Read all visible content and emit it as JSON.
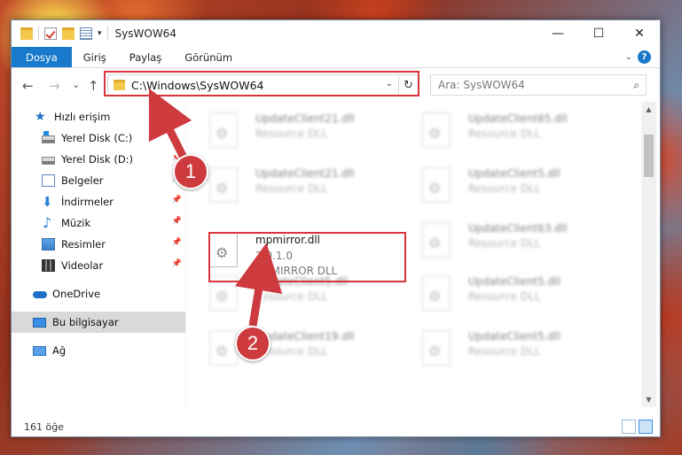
{
  "window": {
    "title": "SysWOW64",
    "minimize_glyph": "—",
    "maximize_glyph": "☐",
    "close_glyph": "✕"
  },
  "ribbon": {
    "tabs": [
      {
        "label": "Dosya",
        "active": true
      },
      {
        "label": "Giriş"
      },
      {
        "label": "Paylaş"
      },
      {
        "label": "Görünüm"
      }
    ]
  },
  "navigation": {
    "back_glyph": "←",
    "forward_glyph": "→",
    "recent_glyph": "⌄",
    "up_glyph": "↑",
    "address_path": "C:\\Windows\\SysWOW64",
    "address_dropdown_glyph": "⌄",
    "refresh_glyph": "↻",
    "search_placeholder": "Ara: SysWOW64",
    "search_icon_glyph": "⌕"
  },
  "sidebar": {
    "items": [
      {
        "label": "Hızlı erişim",
        "icon": "star-icon"
      },
      {
        "label": "Yerel Disk (C:)",
        "icon": "drive-icon"
      },
      {
        "label": "Yerel Disk (D:)",
        "icon": "drive-icon",
        "pinned": true
      },
      {
        "label": "Belgeler",
        "icon": "documents-icon",
        "pinned": true
      },
      {
        "label": "İndirmeler",
        "icon": "downloads-icon",
        "pinned": true
      },
      {
        "label": "Müzik",
        "icon": "music-icon",
        "pinned": true
      },
      {
        "label": "Resimler",
        "icon": "pictures-icon",
        "pinned": true
      },
      {
        "label": "Videolar",
        "icon": "videos-icon",
        "pinned": true
      },
      {
        "label": "OneDrive",
        "icon": "onedrive-icon"
      },
      {
        "label": "Bu bilgisayar",
        "icon": "this-pc-icon",
        "selected": true
      },
      {
        "label": "Ağ",
        "icon": "network-icon"
      }
    ],
    "pin_glyph": "📌"
  },
  "files": {
    "left_column": [
      {
        "name": "UpdateClient21.dll",
        "type": "Resource DLL"
      },
      {
        "name": "UpdateClient21.dll",
        "type": "Resource DLL"
      },
      {
        "name": "mpmirror.dll",
        "version": "2.0.1.0",
        "type": "MPMIRROR DLL"
      },
      {
        "name": "UpdateClient5.dll",
        "type": "Resource DLL"
      },
      {
        "name": "UpdateClient19.dll",
        "type": "Resource DLL"
      }
    ],
    "right_column": [
      {
        "name": "UpdateClient65.dll",
        "type": "Resource DLL"
      },
      {
        "name": "UpdateClient5.dll",
        "type": "Resource DLL"
      },
      {
        "name": "UpdateClient63.dll",
        "type": "Resource DLL"
      },
      {
        "name": "UpdateClient5.dll",
        "type": "Resource DLL"
      },
      {
        "name": "UpdateClient5.dll",
        "type": "Resource DLL"
      }
    ]
  },
  "status": {
    "item_count": "161 öğe"
  },
  "annotations": {
    "step1": "1",
    "step2": "2",
    "color": "#cd3b3f"
  },
  "colors": {
    "accent": "#1979ca",
    "highlight_border": "#d9343a"
  }
}
